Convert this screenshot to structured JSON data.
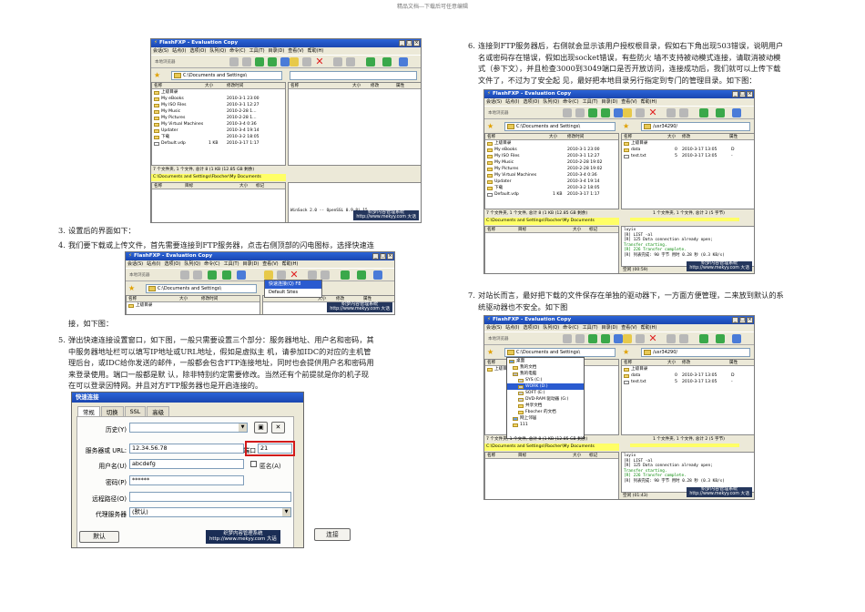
{
  "header_note": "精品文档---下载后可任意编辑",
  "paragraphs": {
    "p3": {
      "num": "3.",
      "text": "设置后的界面如下："
    },
    "p4": {
      "num": "4.",
      "line1": "我们要下载或上传文件，首先需要连接到FTP服务器，点击右侧顶部的闪电图标，选择快速连",
      "line2": "接，如下图："
    },
    "p5": {
      "num": "5.",
      "lines": [
        "弹出快速连接设置窗口，如下图，一般只需要设置三个部分：服务器地址、用户名和密码，其",
        "中服务器地址栏可以填写IP地址或URL地址，假如是虚拟主 机，请参加IDC的对应的主机管",
        "理后台，或IDC给你发送的邮件，一般都会包含FTP连接地址，同时也会提供用户名和密码用",
        "来登录使用。端口一般都是默 认，除非特别约定需要修改。当然还有个前提就是你的机子现",
        "在可以登录因特网。并且对方FTP服务器也是开启连接的。"
      ]
    },
    "p6": {
      "num": "6.",
      "lines": [
        "连接到FTP服务器后，右侧就会显示该用户授权根目录，假如右下角出现503错误，说明用户",
        "名或密码存在错误，假如出现socket错误，有些防火 墙不支持被动模式连接，请取消被动模",
        "式（参下文），并且检查3000到3049端口是否开放访问，连接成功后，我们就可以上传下载",
        "文件了，不过为了安全起 见，最好把本地目录另行指定到专门的管理目录。如下图："
      ]
    },
    "p7": {
      "num": "7.",
      "lines": [
        "对站长而言，最好把下载的文件保存在单独的驱动器下，一方面方便管理，二来放到默认的系",
        "统驱动器也不安全。如下图"
      ]
    }
  },
  "app": {
    "title": "FlashFXP - Evaluation Copy",
    "menu": [
      "会话(S)",
      "站点(I)",
      "选项(O)",
      "队列(Q)",
      "命令(C)",
      "工具(T)",
      "目录(D)",
      "查看(V)",
      "帮助(H)"
    ],
    "local_disconnected": "本地浏览器",
    "local_path": "C:\\Documents and Settings\\",
    "remote_path": "/usr34290/",
    "columns_local": [
      "名称",
      "大小",
      "修改时间"
    ],
    "columns_remote": [
      "名称",
      "大小",
      "修改",
      "属性"
    ],
    "up_dir": "上级目录",
    "local_files": [
      {
        "name": "My eBooks",
        "size": "",
        "date": "2010-3-1 23:00"
      },
      {
        "name": "My ISO Files",
        "size": "",
        "date": "2010-3-1 12:27"
      },
      {
        "name": "My Music",
        "size": "",
        "date": "2010-2-28 1..."
      },
      {
        "name": "My Pictures",
        "size": "",
        "date": "2010-2-28 1..."
      },
      {
        "name": "My Virtual Machines",
        "size": "",
        "date": "2010-3-4 0:36"
      },
      {
        "name": "Updater",
        "size": "",
        "date": "2010-3-4 19:14"
      },
      {
        "name": "下载",
        "size": "",
        "date": "2010-3-2 18:05"
      },
      {
        "name": "Default.vdp",
        "size": "1 KB",
        "date": "2010-3-17 1:17"
      }
    ],
    "local_files_b": [
      {
        "name": "My eBooks",
        "size": "",
        "date": "2010-3-1 23:00"
      },
      {
        "name": "My ISO Files",
        "size": "",
        "date": "2010-3-1 12:27"
      },
      {
        "name": "My Music",
        "size": "",
        "date": "2010-2-28 19:02"
      },
      {
        "name": "My Pictures",
        "size": "",
        "date": "2010-2-28 19:02"
      },
      {
        "name": "My Virtual Machines",
        "size": "",
        "date": "2010-3-4 0:36"
      },
      {
        "name": "Updater",
        "size": "",
        "date": "2010-3-4 19:14"
      },
      {
        "name": "下载",
        "size": "",
        "date": "2010-3-2 18:05"
      },
      {
        "name": "Default.vdp",
        "size": "1 KB",
        "date": "2010-3-17 1:17"
      }
    ],
    "remote_files": [
      {
        "name": "data",
        "size": "0",
        "date": "2010-3-17 13:05",
        "attr": "D"
      },
      {
        "name": "test.txt",
        "size": "5",
        "date": "2010-3-17 13:05",
        "attr": "-"
      }
    ],
    "local_status": "7 个文件夹, 1 个文件, 总计 8 (1 KB (12.85 GB 剩余)",
    "local_status_path": "C:\\Documents and Settings\\Fbocher\\My Documents",
    "remote_status": "1 个文件夹, 1 个文件, 总计 2 (5 字节)",
    "queue_columns": [
      "名称",
      "目标",
      "大小",
      "标记"
    ],
    "winsock": "WinSock 2.0 -- OpenSSL 0.9.8i 15",
    "log_lines": [
      "[R] LIST -al",
      "[R] 125 Data connection already open;",
      "Transfer starting.",
      "[R] 226 Transfer complete.",
      "[R] 列表完成: 90 字节 用时 0.28 秒 (0.3 KB/s)"
    ],
    "log_header": "luyix",
    "idle_label": "空闲",
    "idle_time_a": "(00:59)",
    "idle_time_b": "(01:43)",
    "dropdown": [
      "快速连接(Q) F8",
      "Default Sites"
    ],
    "tree": [
      "桌面",
      "我的文档",
      "我的电脑",
      "SYS (C:)",
      "WORK (D:)",
      "SOFT (E:)",
      "DVD-RAM 驱动器 (G:)",
      "共享文档",
      "Fbocher 的文档",
      "网上邻居",
      "111"
    ],
    "watermark_line1": "织梦内容管理系统",
    "watermark_line2": "http://www.mekyy.com 大话",
    "watermark_line3": "DEDECMS.COM"
  },
  "quick_connect": {
    "title": "快速连接",
    "tabs": [
      "常规",
      "切换",
      "SSL",
      "高级"
    ],
    "history_label": "历史(Y)",
    "server_label": "服务器或 URL:",
    "server_value": "12.34.56.78",
    "port_label": "端口",
    "port_value": "21",
    "user_label": "用户名(U)",
    "user_value": "abcdefg",
    "anon_label": "匿名(A)",
    "pass_label": "密码(P)",
    "pass_value": "******",
    "remote_label": "远程路径(O)",
    "proxy_label": "代理服务器",
    "proxy_value": "(默认)",
    "default_btn": "默认",
    "connect_btn": "连接",
    "watermark_line1": "织梦内容管理系统",
    "watermark_line2": "http://www.mekyy.com 大话"
  }
}
